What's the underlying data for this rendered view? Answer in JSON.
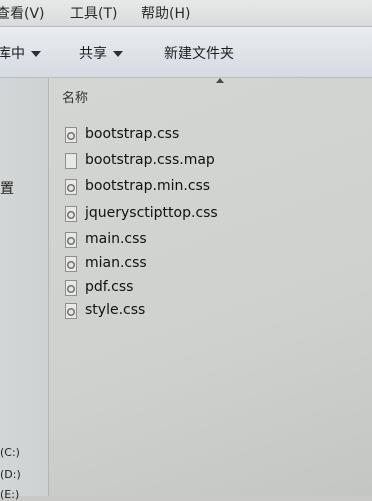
{
  "menu": {
    "view": "查看(V)",
    "tools": "工具(T)",
    "help": "帮助(H)"
  },
  "toolbar": {
    "organize": "库中",
    "share": "共享",
    "new_folder": "新建文件夹"
  },
  "nav": {
    "partial_item": "置",
    "drive_c": "(C:)",
    "drive_d": "(D:)",
    "drive_e": "(E:)"
  },
  "columns": {
    "name": "名称"
  },
  "files": [
    {
      "name": "bootstrap.css",
      "icon": "css-file-icon"
    },
    {
      "name": "bootstrap.css.map",
      "icon": "blank-file-icon"
    },
    {
      "name": "bootstrap.min.css",
      "icon": "css-file-icon"
    },
    {
      "name": "jquerysctipttop.css",
      "icon": "css-file-icon"
    },
    {
      "name": "main.css",
      "icon": "css-file-icon"
    },
    {
      "name": "mian.css",
      "icon": "css-file-icon"
    },
    {
      "name": "pdf.css",
      "icon": "css-file-icon"
    },
    {
      "name": "style.css",
      "icon": "css-file-icon"
    }
  ]
}
